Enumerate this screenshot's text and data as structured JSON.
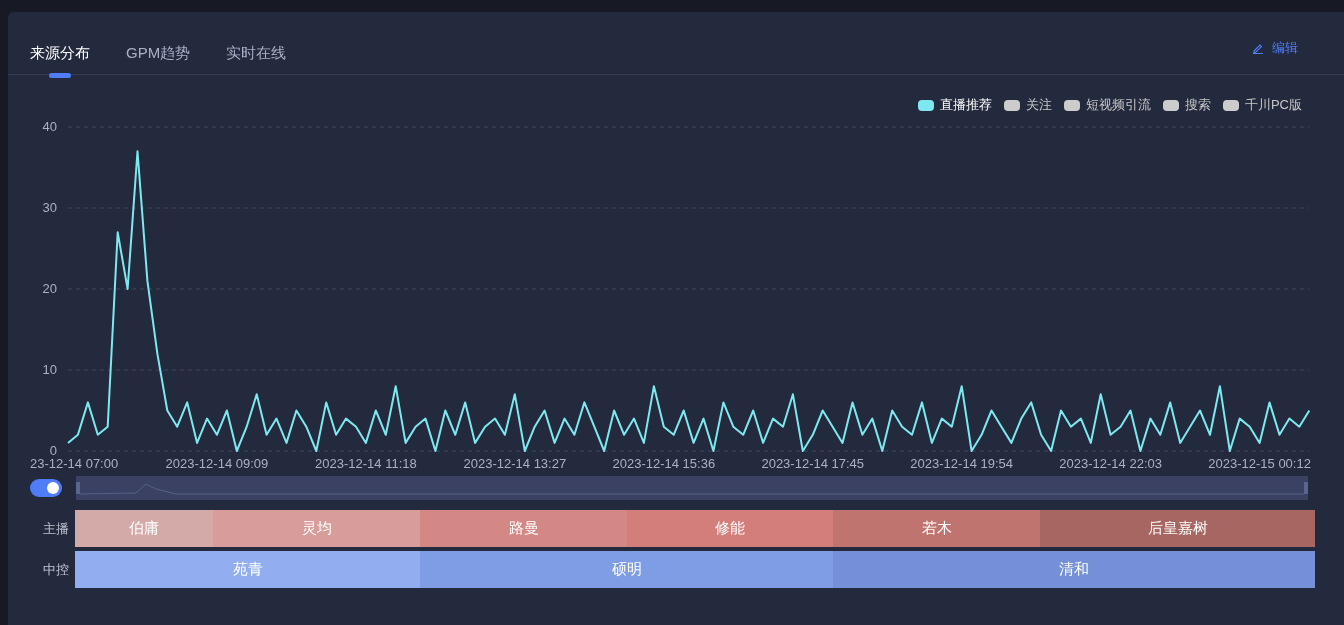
{
  "tabs": [
    {
      "label": "来源分布",
      "selected": true
    },
    {
      "label": "GPM趋势",
      "selected": false
    },
    {
      "label": "实时在线",
      "selected": false
    }
  ],
  "edit_button": {
    "label": "编辑"
  },
  "legend": [
    {
      "label": "关注",
      "selected": false
    },
    {
      "label": "短视频引流",
      "selected": false
    },
    {
      "label": "搜索",
      "selected": false
    },
    {
      "label": "千川PC版",
      "selected": false
    }
  ],
  "chart_data": {
    "type": "line",
    "grid": true,
    "ylim": [
      0,
      40
    ],
    "yticks": [
      0,
      10,
      20,
      30,
      40
    ],
    "categories": [
      "23-12-14 07:00",
      null,
      null,
      null,
      null,
      null,
      null,
      null,
      null,
      null,
      null,
      null,
      null,
      null,
      null,
      "2023-12-14 09:09",
      null,
      null,
      null,
      null,
      null,
      null,
      null,
      null,
      null,
      null,
      null,
      null,
      null,
      null,
      "2023-12-14 11:18",
      null,
      null,
      null,
      null,
      null,
      null,
      null,
      null,
      null,
      null,
      null,
      null,
      null,
      null,
      "2023-12-14 13:27",
      null,
      null,
      null,
      null,
      null,
      null,
      null,
      null,
      null,
      null,
      null,
      null,
      null,
      null,
      "2023-12-14 15:36",
      null,
      null,
      null,
      null,
      null,
      null,
      null,
      null,
      null,
      null,
      null,
      null,
      null,
      null,
      "2023-12-14 17:45",
      null,
      null,
      null,
      null,
      null,
      null,
      null,
      null,
      null,
      null,
      null,
      null,
      null,
      null,
      "2023-12-14 19:54",
      null,
      null,
      null,
      null,
      null,
      null,
      null,
      null,
      null,
      null,
      null,
      null,
      null,
      null,
      "2023-12-14 22:03",
      null,
      null,
      null,
      null,
      null,
      null,
      null,
      null,
      null,
      null,
      null,
      null,
      null,
      null,
      "2023-12-15 00:12",
      null,
      null,
      null,
      null,
      null
    ],
    "series": [
      {
        "name": "直播推荐",
        "color": "#7ee8f0",
        "values": [
          1,
          2,
          6,
          2,
          3,
          27,
          20,
          37,
          21,
          12,
          5,
          3,
          6,
          1,
          4,
          2,
          5,
          0,
          3,
          7,
          2,
          4,
          1,
          5,
          3,
          0,
          6,
          2,
          4,
          3,
          1,
          5,
          2,
          8,
          1,
          3,
          4,
          0,
          5,
          2,
          6,
          1,
          3,
          4,
          2,
          7,
          0,
          3,
          5,
          1,
          4,
          2,
          6,
          3,
          0,
          5,
          2,
          4,
          1,
          8,
          3,
          2,
          5,
          1,
          4,
          0,
          6,
          3,
          2,
          5,
          1,
          4,
          3,
          7,
          0,
          2,
          5,
          3,
          1,
          6,
          2,
          4,
          0,
          5,
          3,
          2,
          6,
          1,
          4,
          3,
          8,
          0,
          2,
          5,
          3,
          1,
          4,
          6,
          2,
          0,
          5,
          3,
          4,
          1,
          7,
          2,
          3,
          5,
          0,
          4,
          2,
          6,
          1,
          3,
          5,
          2,
          8,
          0,
          4,
          3,
          1,
          6,
          2,
          4,
          3,
          5
        ]
      }
    ]
  },
  "zoom_toggle": {
    "on": true
  },
  "range_slider": {
    "level": 1
  },
  "schedule": [
    {
      "label": "主播",
      "segments": [
        {
          "name": "伯庸",
          "color": "#d4aaa8"
        },
        {
          "name": "灵均",
          "color": "#d89c9a"
        },
        {
          "name": "路曼",
          "color": "#d48886"
        },
        {
          "name": "修能",
          "color": "#d47e7c"
        },
        {
          "name": "若木",
          "color": "#c07470"
        },
        {
          "name": "后皇嘉树",
          "color": "#a86662"
        }
      ]
    },
    {
      "label": "中控",
      "segments": [
        {
          "name": "苑青",
          "color": "#93aef0"
        },
        {
          "name": "硕明",
          "color": "#7f9de4"
        },
        {
          "name": "清和",
          "color": "#7590d6"
        }
      ]
    }
  ]
}
